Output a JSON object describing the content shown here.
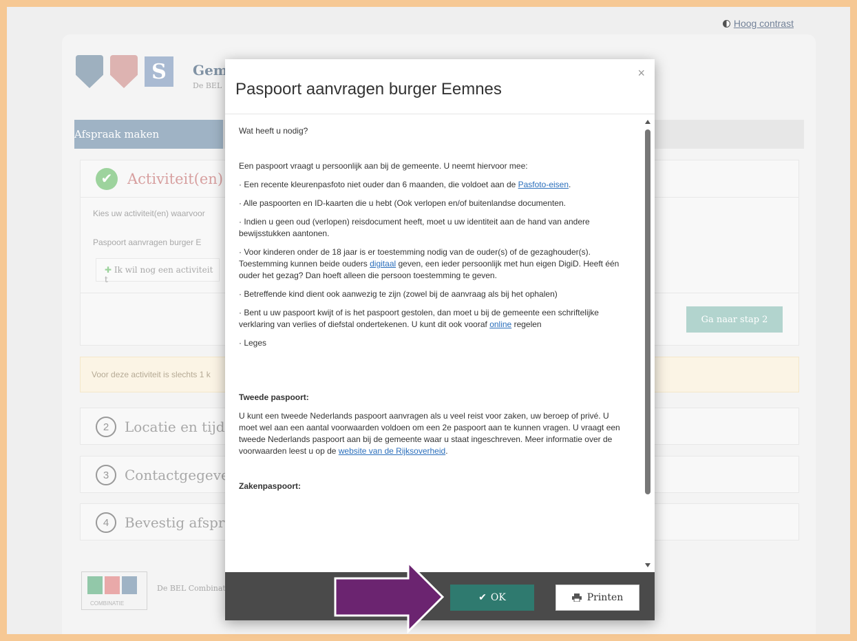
{
  "header": {
    "contrast_label": "Hoog contrast",
    "org_title": "Gem",
    "org_subtitle": "De BEL",
    "logo_letter": "S"
  },
  "tabs": {
    "active": "Afspraak maken"
  },
  "step1": {
    "title": "Activiteit(en)",
    "choose_text": "Kies uw activiteit(en) waarvoor",
    "selected": "Paspoort aanvragen burger E",
    "add_button": "Ik wil nog een activiteit t",
    "next_button": "Ga naar stap 2"
  },
  "warning": {
    "text": "Voor deze activiteit is slechts 1 k"
  },
  "steps": [
    {
      "number": "2",
      "title": "Locatie en tijdst"
    },
    {
      "number": "3",
      "title": "Contactgegever"
    },
    {
      "number": "4",
      "title": "Bevestig afspraa"
    }
  ],
  "footer": {
    "logo_caption": "COMBINATIE",
    "text": "De BEL Combinat"
  },
  "modal": {
    "title": "Paspoort aanvragen burger Eemnes",
    "close": "×",
    "question": "Wat heeft u nodig?",
    "intro": "Een paspoort vraagt u persoonlijk aan bij de gemeente. U neemt hiervoor mee:",
    "item1_pre": "· Een recente kleurenpasfoto niet ouder dan 6 maanden, die voldoet aan de ",
    "item1_link": "Pasfoto-eisen",
    "item1_post": ".",
    "item2": "· Alle paspoorten en ID-kaarten die u hebt (Ook verlopen en/of buitenlandse documenten.",
    "item3": "· Indien u geen oud (verlopen) reisdocument heeft, moet u uw identiteit aan de hand van andere bewijsstukken aantonen.",
    "item4_pre": "· Voor kinderen onder de 18 jaar is er toestemming nodig van de ouder(s) of de gezaghouder(s). Toestemming kunnen beide ouders ",
    "item4_link": "digitaal",
    "item4_post": " geven, een ieder persoonlijk met hun eigen DigiD. Heeft één ouder het gezag? Dan hoeft alleen die persoon toestemming te geven.",
    "item5": "· Betreffende kind dient ook aanwezig te zijn (zowel bij de aanvraag als bij het ophalen)",
    "item6_pre": "· Bent u uw paspoort kwijt of is het paspoort gestolen, dan moet u bij de gemeente een schriftelijke verklaring van verlies of diefstal ondertekenen. U kunt dit ook vooraf ",
    "item6_link": "online",
    "item6_post": " regelen",
    "item7": "· Leges",
    "second_heading": "Tweede paspoort:",
    "second_pre": "U kunt een tweede Nederlands paspoort aanvragen als u veel reist voor zaken, uw beroep of privé. U moet wel aan een aantal voorwaarden voldoen om een 2e paspoort aan te kunnen vragen. U vraagt een tweede Nederlands paspoort aan bij de gemeente waar u staat ingeschreven. Meer informatie over de voorwaarden leest u op de ",
    "second_link": "website van de Rijksoverheid",
    "second_post": ".",
    "zaken_heading": "Zakenpaspoort:",
    "ok_label": "OK",
    "print_label": "Printen"
  },
  "colors": {
    "page_bg": "#f6c894",
    "tab_active": "#8fa6bb",
    "ok_button": "#2f7a6f",
    "footer_bar": "#4a4a4a",
    "arrow": "#6b2470"
  }
}
